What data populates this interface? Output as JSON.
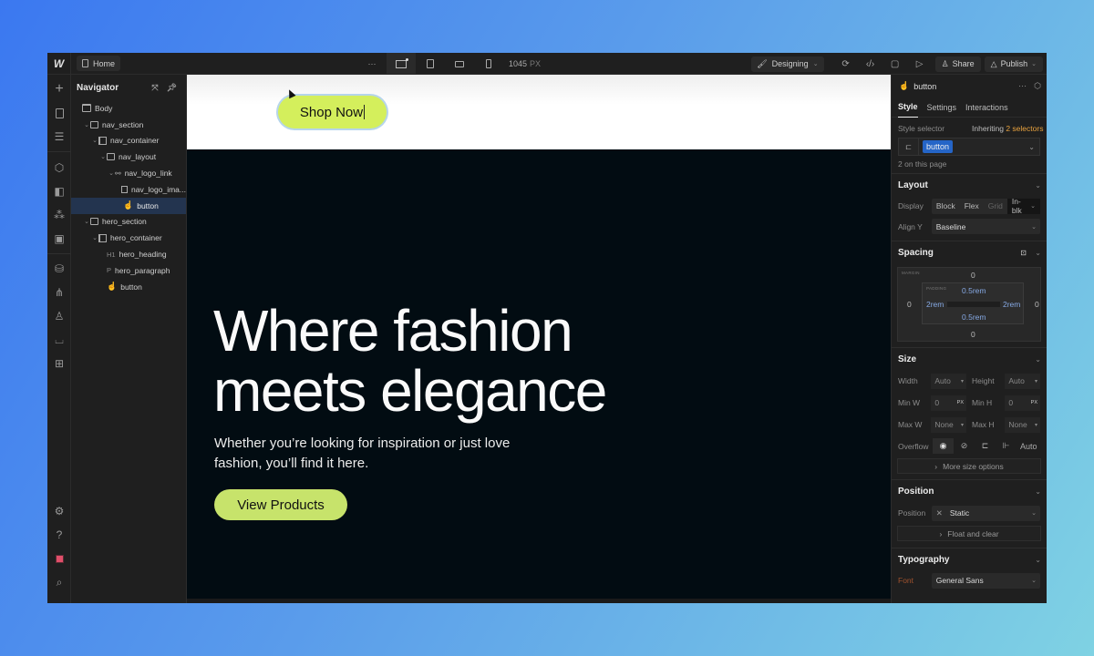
{
  "topbar": {
    "logo": "W",
    "page_name": "Home",
    "more_label": "···",
    "canvas_width_value": "1045",
    "canvas_width_unit": "PX",
    "mode_label": "Designing",
    "share_label": "Share",
    "publish_label": "Publish"
  },
  "rail": {
    "icons": [
      "add-icon",
      "pages-icon",
      "navigator-icon",
      "components-icon",
      "variables-icon",
      "styles-icon",
      "assets-icon",
      "cms-icon",
      "logic-icon",
      "users-icon",
      "ecommerce-icon",
      "apps-icon",
      "settings-icon",
      "help-icon",
      "record-icon",
      "search-icon"
    ]
  },
  "navigator": {
    "title": "Navigator",
    "items": [
      {
        "label": "Body",
        "type": "body",
        "depth": 0
      },
      {
        "label": "nav_section",
        "type": "section",
        "depth": 1
      },
      {
        "label": "nav_container",
        "type": "container",
        "depth": 2
      },
      {
        "label": "nav_layout",
        "type": "div",
        "depth": 3
      },
      {
        "label": "nav_logo_link",
        "type": "link",
        "depth": 4
      },
      {
        "label": "nav_logo_ima...",
        "type": "image",
        "depth": 5
      },
      {
        "label": "button",
        "type": "button",
        "depth": 5,
        "selected": true
      },
      {
        "label": "hero_section",
        "type": "section",
        "depth": 1
      },
      {
        "label": "hero_container",
        "type": "container",
        "depth": 2
      },
      {
        "label": "hero_heading",
        "type": "heading",
        "tag": "H1",
        "depth": 3
      },
      {
        "label": "hero_paragraph",
        "type": "paragraph",
        "tag": "P",
        "depth": 3
      },
      {
        "label": "button",
        "type": "button",
        "depth": 3
      }
    ]
  },
  "canvas": {
    "nav_button_label": "Shop Now",
    "hero_heading_line1": "Where fashion",
    "hero_heading_line2": "meets elegance",
    "hero_paragraph": "Whether you’re looking for inspiration or just love fashion, you’ll find it here.",
    "hero_button_label": "View Products",
    "accent_color": "#d4ef5c",
    "background_color": "#020c12"
  },
  "panel": {
    "element_name": "button",
    "tabs": [
      "Style",
      "Settings",
      "Interactions"
    ],
    "active_tab": "Style",
    "style_selector_label": "Style selector",
    "inheriting_prefix": "Inheriting",
    "inheriting_count": "2 selectors",
    "selector_chip": "button",
    "on_page_count": "2 on this page",
    "layout": {
      "title": "Layout",
      "display_label": "Display",
      "display_options": [
        "Block",
        "Flex",
        "Grid"
      ],
      "display_value": "In-blk",
      "align_y_label": "Align Y",
      "align_y_value": "Baseline"
    },
    "spacing": {
      "title": "Spacing",
      "margin_label": "MARGIN",
      "padding_label": "PADDING",
      "margin_top": "0",
      "margin_right": "0",
      "margin_bottom": "0",
      "margin_left": "0",
      "padding_top": "0.5rem",
      "padding_right": "2rem",
      "padding_bottom": "0.5rem",
      "padding_left": "2rem"
    },
    "size": {
      "title": "Size",
      "width_label": "Width",
      "width_value": "Auto",
      "height_label": "Height",
      "height_value": "Auto",
      "min_w_label": "Min W",
      "min_w_value": "0",
      "min_w_unit": "PX",
      "min_h_label": "Min H",
      "min_h_value": "0",
      "min_h_unit": "PX",
      "max_w_label": "Max W",
      "max_w_value": "None",
      "max_h_label": "Max H",
      "max_h_value": "None",
      "overflow_label": "Overflow",
      "overflow_auto": "Auto",
      "more_label": "More size options"
    },
    "position": {
      "title": "Position",
      "position_label": "Position",
      "position_value": "Static",
      "float_label": "Float and clear"
    },
    "typography": {
      "title": "Typography",
      "font_label": "Font",
      "font_value": "General Sans"
    }
  }
}
